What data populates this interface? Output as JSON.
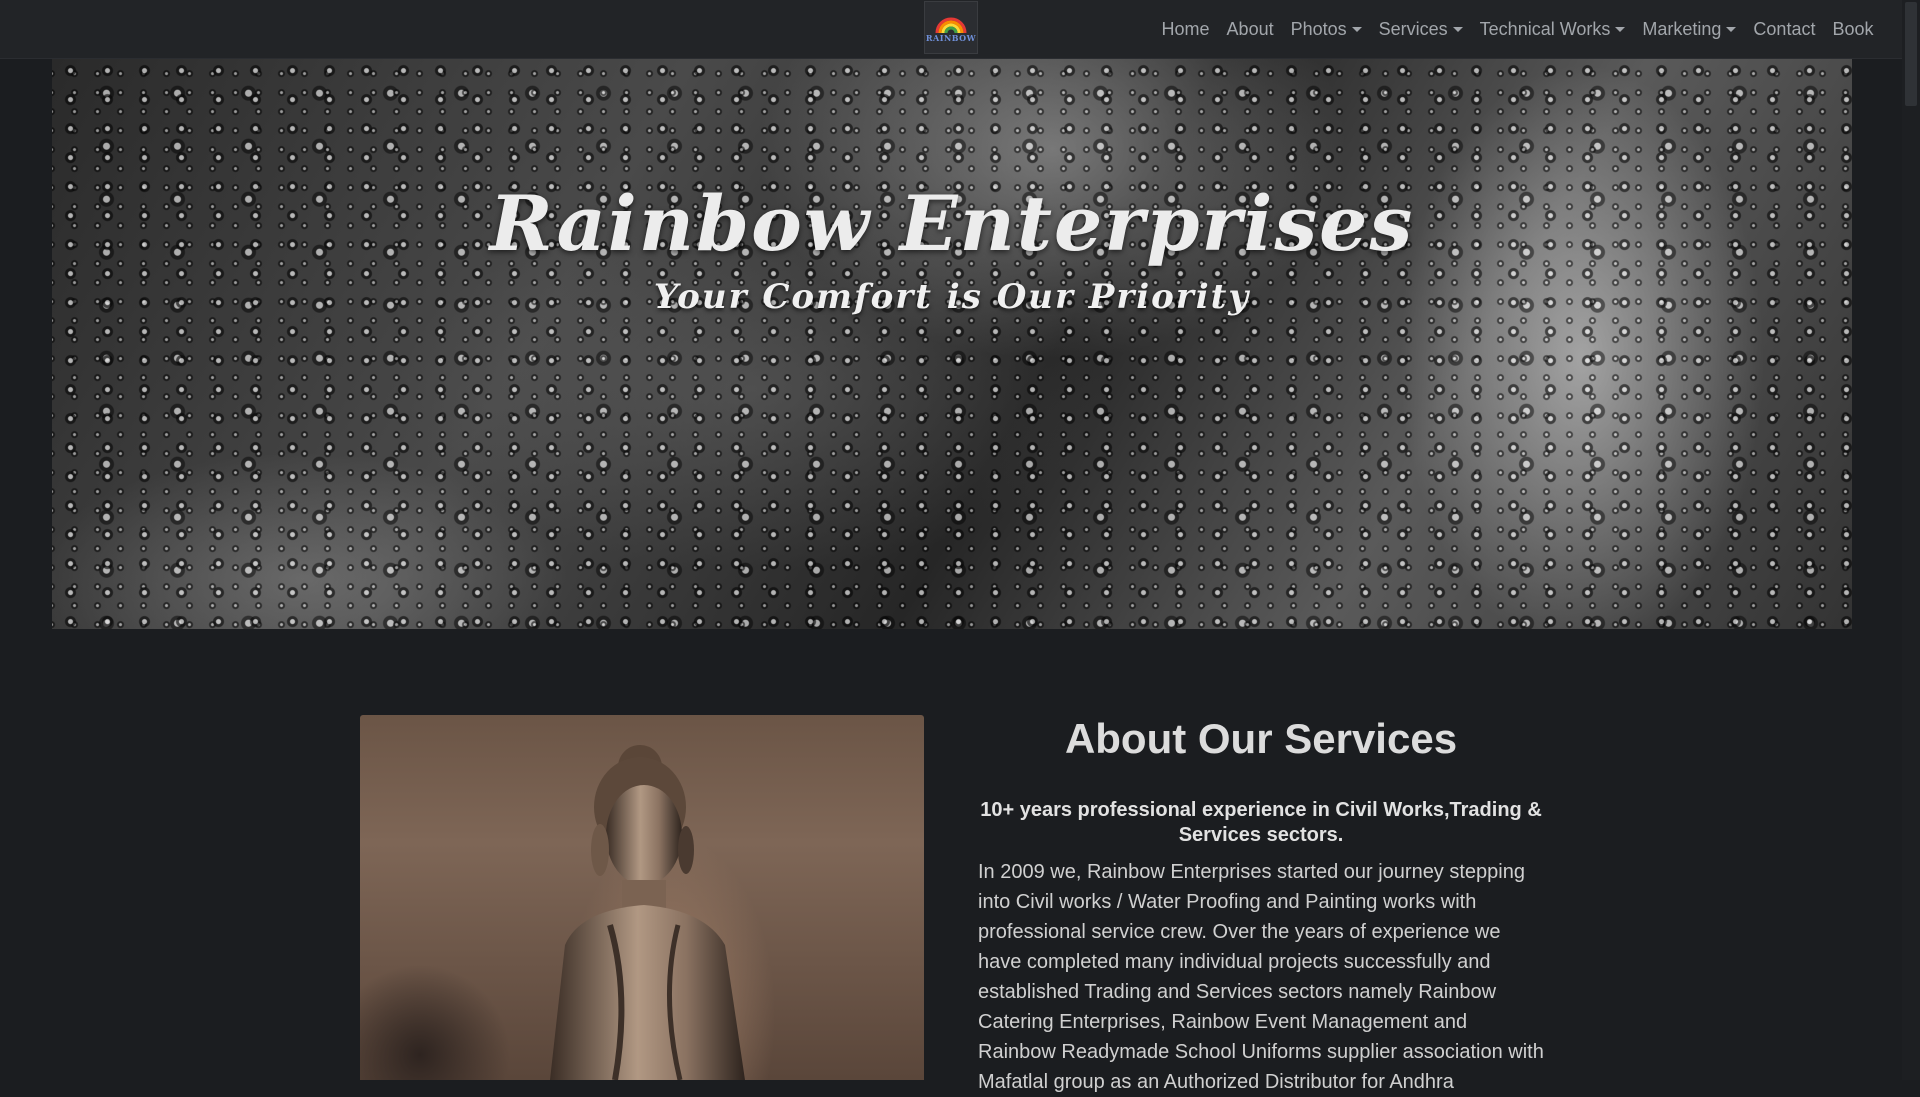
{
  "navbar": {
    "logo_text": "RAINBOW",
    "items": [
      {
        "label": "Home",
        "dropdown": false
      },
      {
        "label": "About",
        "dropdown": false
      },
      {
        "label": "Photos",
        "dropdown": true
      },
      {
        "label": "Services",
        "dropdown": true
      },
      {
        "label": "Technical Works",
        "dropdown": true
      },
      {
        "label": "Marketing",
        "dropdown": true
      },
      {
        "label": "Contact",
        "dropdown": false
      },
      {
        "label": "Book",
        "dropdown": false
      }
    ]
  },
  "hero": {
    "title": "Rainbow Enterprises",
    "subtitle": "Your Comfort is Our Priority"
  },
  "about": {
    "title": "About Our Services",
    "subtitle": "10+ years professional experience in Civil Works,Trading & Services sectors.",
    "body": "In 2009 we, Rainbow Enterprises started our journey stepping into Civil works / Water Proofing and Painting works with professional service crew. Over the years of experience we have completed many individual projects successfully and established Trading and Services sectors namely Rainbow Catering Enterprises, Rainbow Event Management and Rainbow Readymade School Uniforms supplier association with Mafatlal group as an Authorized Distributor for Andhra"
  },
  "colors": {
    "background": "#1b1d20",
    "navbar": "#222427",
    "nav_text": "#a2a6ab"
  }
}
